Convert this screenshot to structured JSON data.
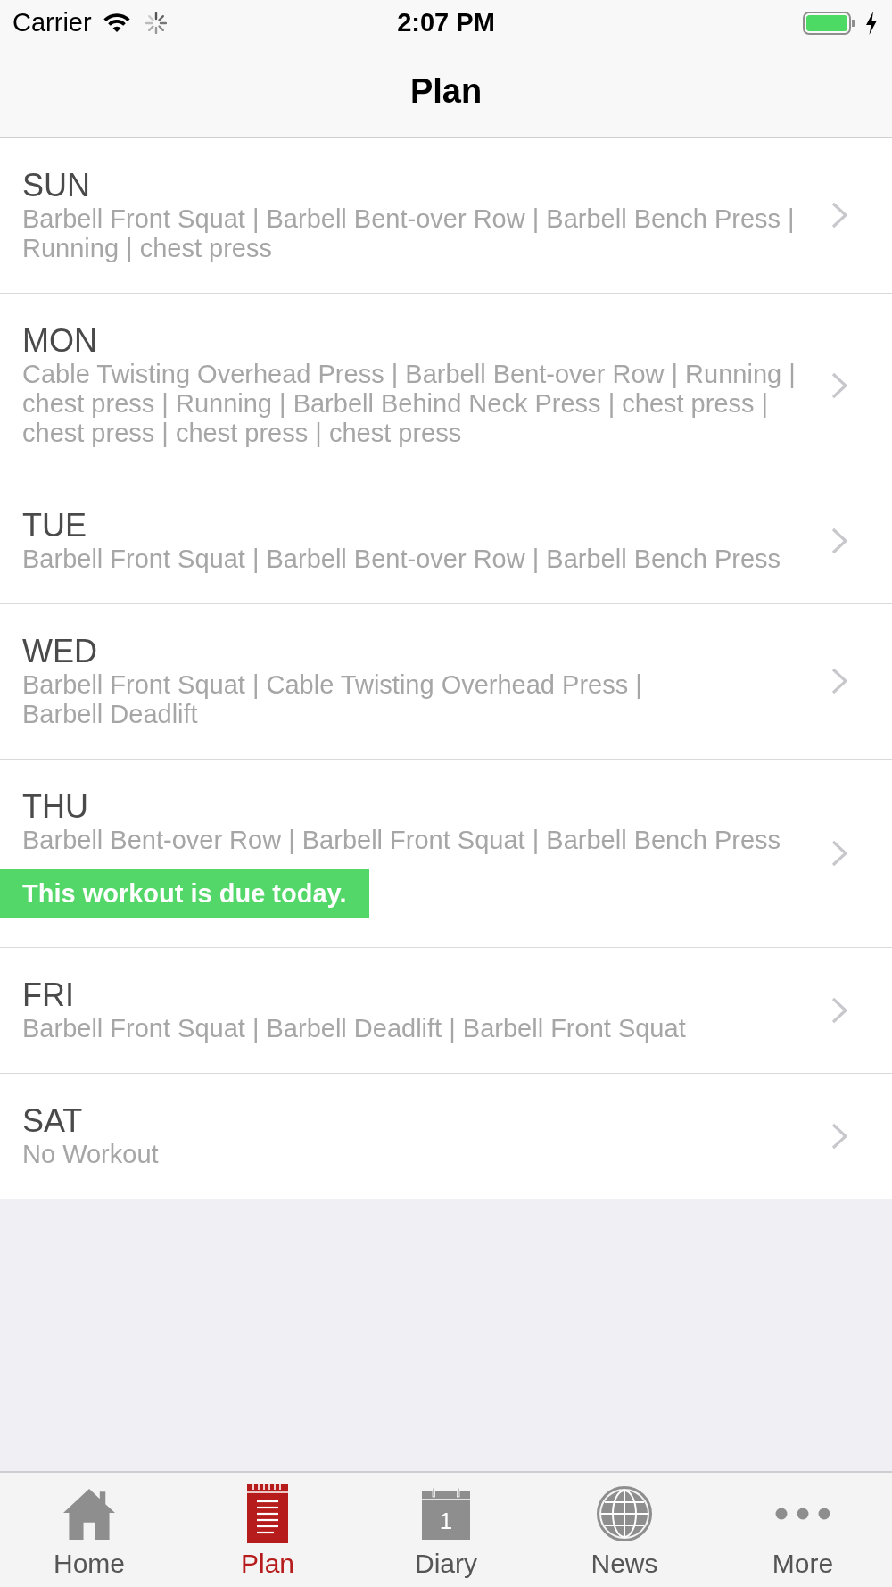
{
  "status_bar": {
    "carrier": "Carrier",
    "time": "2:07 PM"
  },
  "nav_bar": {
    "title": "Plan"
  },
  "days": [
    {
      "day": "SUN",
      "exercises": "Barbell Front Squat | Barbell Bent-over Row | Barbell Bench Press | Running | chest press"
    },
    {
      "day": "MON",
      "exercises": "Cable Twisting Overhead Press | Barbell Bent-over Row | Running | chest press | Running | Barbell Behind Neck Press | chest press | chest press | chest press | chest press"
    },
    {
      "day": "TUE",
      "exercises": "Barbell Front Squat | Barbell Bent-over Row | Barbell Bench Press"
    },
    {
      "day": "WED",
      "exercises": "Barbell Front Squat | Cable Twisting Overhead Press | Barbell Deadlift"
    },
    {
      "day": "THU",
      "exercises": "Barbell Bent-over Row | Barbell Front Squat | Barbell Bench Press",
      "notice": "This workout is due today."
    },
    {
      "day": "FRI",
      "exercises": "Barbell Front Squat | Barbell Deadlift | Barbell Front Squat"
    },
    {
      "day": "SAT",
      "exercises": "No Workout"
    }
  ],
  "tab_bar": {
    "tabs": [
      {
        "label": "Home",
        "selected": false
      },
      {
        "label": "Plan",
        "selected": true
      },
      {
        "label": "Diary",
        "selected": false,
        "icon_text": "1"
      },
      {
        "label": "News",
        "selected": false
      },
      {
        "label": "More",
        "selected": false
      }
    ]
  }
}
